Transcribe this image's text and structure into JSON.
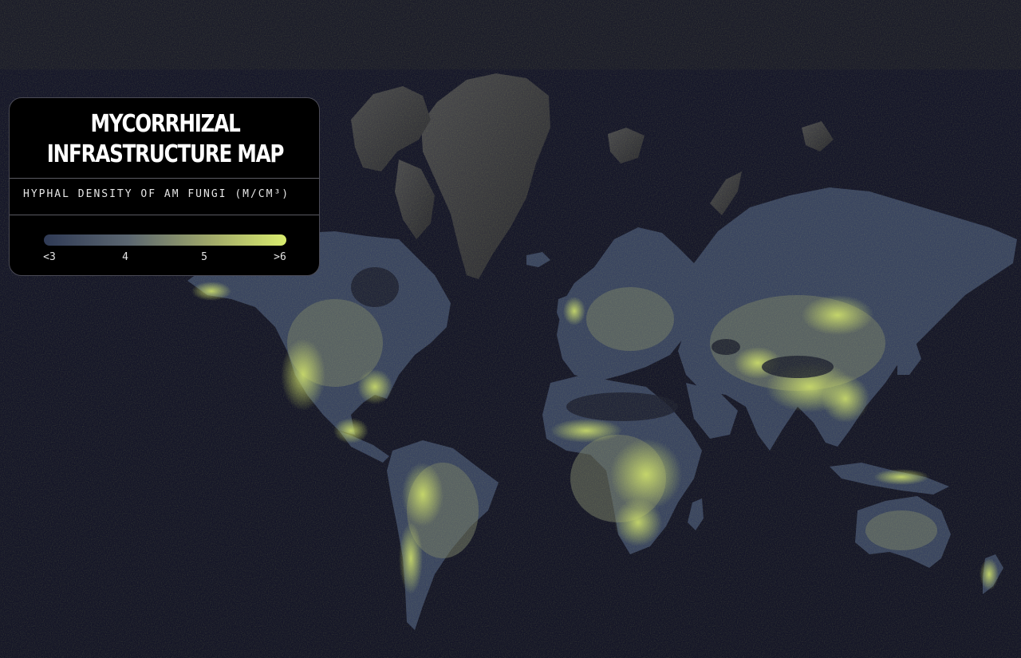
{
  "legend": {
    "title_line1": "MYCORRHIZAL",
    "title_line2": "INFRASTRUCTURE MAP",
    "subtitle": "HYPHAL DENSITY OF AM FUNGI (M/CM³)",
    "ticks": [
      "<3",
      "4",
      "5",
      ">6"
    ],
    "gradient_colors": [
      "#2f3a55",
      "#5b6670",
      "#a3ab6a",
      "#d9ec6e"
    ]
  },
  "colors": {
    "ocean": "#141527",
    "land_low": "#38425c",
    "land_mid": "#6a7264",
    "land_high": "#cfe06a",
    "ice_relief": "#3b3b40"
  },
  "map": {
    "projection": "mercator",
    "theme": "dark"
  }
}
